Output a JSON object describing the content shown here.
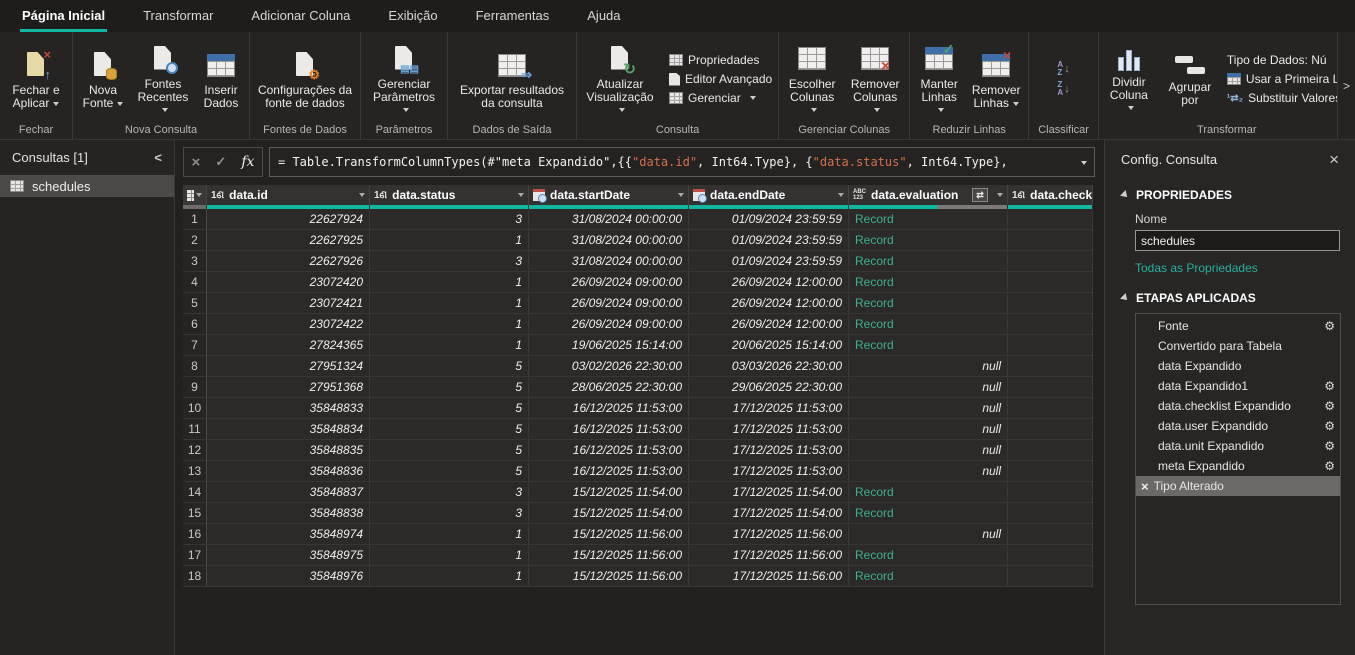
{
  "colors": {
    "accent_teal": "#10b7a3",
    "record_link": "#3fae8f",
    "formula_string": "#d4704e"
  },
  "menu": {
    "tabs": [
      {
        "label": "Página Inicial",
        "active": true
      },
      {
        "label": "Transformar",
        "active": false
      },
      {
        "label": "Adicionar Coluna",
        "active": false
      },
      {
        "label": "Exibição",
        "active": false
      },
      {
        "label": "Ferramentas",
        "active": false
      },
      {
        "label": "Ajuda",
        "active": false
      }
    ]
  },
  "ribbon": {
    "groups": [
      {
        "label": "Fechar"
      },
      {
        "label": "Nova Consulta"
      },
      {
        "label": "Fontes de Dados"
      },
      {
        "label": "Parâmetros"
      },
      {
        "label": "Dados de Saída"
      },
      {
        "label": "Consulta"
      },
      {
        "label": "Gerenciar Colunas"
      },
      {
        "label": "Reduzir Linhas"
      },
      {
        "label": "Classificar"
      },
      {
        "label": "Transformar"
      }
    ],
    "buttons": {
      "close_apply": "Fechar e Aplicar",
      "new_source": "Nova Fonte",
      "recent_sources": "Fontes Recentes",
      "enter_data": "Inserir Dados",
      "data_source_settings": "Configurações da fonte de dados",
      "manage_parameters": "Gerenciar Parâmetros",
      "export_results": "Exportar resultados da consulta",
      "refresh_preview": "Atualizar Visualização",
      "properties": "Propriedades",
      "advanced_editor": "Editor Avançado",
      "manage": "Gerenciar",
      "choose_columns": "Escolher Colunas",
      "remove_columns": "Remover Colunas",
      "keep_rows": "Manter Linhas",
      "remove_rows": "Remover Linhas",
      "split_column": "Dividir Coluna",
      "group_by": "Agrupar por",
      "data_type": "Tipo de Dados: Nú",
      "use_first_row": "Usar a Primeira Lin",
      "replace_values": "Substituir Valores"
    }
  },
  "formula_bar": {
    "segments": [
      {
        "type": "plain",
        "text": "= Table.TransformColumnTypes(#\"meta Expandido\",{{"
      },
      {
        "type": "string",
        "text": "\"data.id\""
      },
      {
        "type": "plain",
        "text": ", Int64.Type}, {"
      },
      {
        "type": "string",
        "text": "\"data.status\""
      },
      {
        "type": "plain",
        "text": ", Int64.Type},"
      }
    ]
  },
  "queries_panel": {
    "title": "Consultas [1]",
    "items": [
      {
        "name": "schedules",
        "selected": true
      }
    ]
  },
  "grid": {
    "columns": [
      {
        "icon": "number-icon",
        "label": "data.id",
        "quality_filled": 1
      },
      {
        "icon": "number-icon",
        "label": "data.status",
        "quality_filled": 1
      },
      {
        "icon": "datetime-icon",
        "label": "data.startDate",
        "quality_filled": 1
      },
      {
        "icon": "datetime-icon",
        "label": "data.endDate",
        "quality_filled": 1
      },
      {
        "icon": "anytype-icon",
        "label": "data.evaluation",
        "quality_filled": 0.56,
        "expand": true
      },
      {
        "icon": "number-icon",
        "label": "data.checkl",
        "quality_filled": 1,
        "no_menu": true
      }
    ],
    "rows": [
      [
        "1",
        "22627924",
        "3",
        "31/08/2024 00:00:00",
        "01/09/2024 23:59:59",
        "Record",
        ""
      ],
      [
        "2",
        "22627925",
        "1",
        "31/08/2024 00:00:00",
        "01/09/2024 23:59:59",
        "Record",
        ""
      ],
      [
        "3",
        "22627926",
        "3",
        "31/08/2024 00:00:00",
        "01/09/2024 23:59:59",
        "Record",
        ""
      ],
      [
        "4",
        "23072420",
        "1",
        "26/09/2024 09:00:00",
        "26/09/2024 12:00:00",
        "Record",
        ""
      ],
      [
        "5",
        "23072421",
        "1",
        "26/09/2024 09:00:00",
        "26/09/2024 12:00:00",
        "Record",
        ""
      ],
      [
        "6",
        "23072422",
        "1",
        "26/09/2024 09:00:00",
        "26/09/2024 12:00:00",
        "Record",
        ""
      ],
      [
        "7",
        "27824365",
        "1",
        "19/06/2025 15:14:00",
        "20/06/2025 15:14:00",
        "Record",
        ""
      ],
      [
        "8",
        "27951324",
        "5",
        "03/02/2026 22:30:00",
        "03/03/2026 22:30:00",
        "null",
        ""
      ],
      [
        "9",
        "27951368",
        "5",
        "28/06/2025 22:30:00",
        "29/06/2025 22:30:00",
        "null",
        ""
      ],
      [
        "10",
        "35848833",
        "5",
        "16/12/2025 11:53:00",
        "17/12/2025 11:53:00",
        "null",
        ""
      ],
      [
        "11",
        "35848834",
        "5",
        "16/12/2025 11:53:00",
        "17/12/2025 11:53:00",
        "null",
        ""
      ],
      [
        "12",
        "35848835",
        "5",
        "16/12/2025 11:53:00",
        "17/12/2025 11:53:00",
        "null",
        ""
      ],
      [
        "13",
        "35848836",
        "5",
        "16/12/2025 11:53:00",
        "17/12/2025 11:53:00",
        "null",
        ""
      ],
      [
        "14",
        "35848837",
        "3",
        "15/12/2025 11:54:00",
        "17/12/2025 11:54:00",
        "Record",
        ""
      ],
      [
        "15",
        "35848838",
        "3",
        "15/12/2025 11:54:00",
        "17/12/2025 11:54:00",
        "Record",
        ""
      ],
      [
        "16",
        "35848974",
        "1",
        "15/12/2025 11:56:00",
        "17/12/2025 11:56:00",
        "null",
        ""
      ],
      [
        "17",
        "35848975",
        "1",
        "15/12/2025 11:56:00",
        "17/12/2025 11:56:00",
        "Record",
        ""
      ],
      [
        "18",
        "35848976",
        "1",
        "15/12/2025 11:56:00",
        "17/12/2025 11:56:00",
        "Record",
        ""
      ]
    ]
  },
  "settings_panel": {
    "title": "Config. Consulta",
    "properties_header": "PROPRIEDADES",
    "name_label": "Nome",
    "name_value": "schedules",
    "all_properties_link": "Todas as Propriedades",
    "steps_header": "ETAPAS APLICADAS",
    "steps": [
      {
        "label": "Fonte",
        "gear": true,
        "selected": false
      },
      {
        "label": "Convertido para Tabela",
        "gear": false,
        "selected": false
      },
      {
        "label": "data Expandido",
        "gear": false,
        "selected": false
      },
      {
        "label": "data Expandido1",
        "gear": true,
        "selected": false
      },
      {
        "label": "data.checklist Expandido",
        "gear": true,
        "selected": false
      },
      {
        "label": "data.user Expandido",
        "gear": true,
        "selected": false
      },
      {
        "label": "data.unit Expandido",
        "gear": true,
        "selected": false
      },
      {
        "label": "meta Expandido",
        "gear": true,
        "selected": false
      },
      {
        "label": "Tipo Alterado",
        "gear": false,
        "selected": true
      }
    ]
  }
}
